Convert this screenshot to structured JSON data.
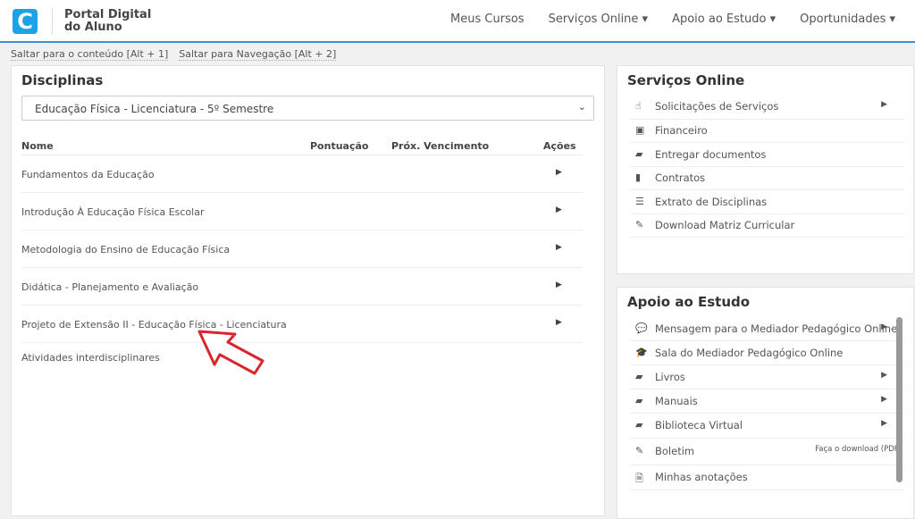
{
  "header": {
    "logo_letter": "C",
    "brand": "Portal Digital do Aluno",
    "nav": [
      "Meus Cursos",
      "Serviços Online ▾",
      "Apoio ao Estudo ▾",
      "Oportunidades ▾"
    ]
  },
  "skip_links": [
    "Saltar para o conteúdo [Alt + 1]",
    "Saltar para Navegação [Alt + 2]"
  ],
  "disciplinas": {
    "title": "Disciplinas",
    "selected_course": "Educação Física - Licenciatura - 5º Semestre",
    "columns": [
      "Nome",
      "Pontuação",
      "Próx. Vencimento",
      "Ações"
    ],
    "rows": [
      {
        "name": "Fundamentos da Educação",
        "action": true
      },
      {
        "name": "Introdução À Educação Física Escolar",
        "action": true
      },
      {
        "name": "Metodologia do Ensino de Educação Física",
        "action": true
      },
      {
        "name": "Didática - Planejamento e Avaliação",
        "action": true
      },
      {
        "name": "Projeto de Extensão II - Educação Física - Licenciatura",
        "action": true
      },
      {
        "name": "Atividades interdisciplinares",
        "action": false
      }
    ]
  },
  "servicos": {
    "title": "Serviços Online",
    "items": [
      {
        "icon": "hand-pointer-icon",
        "glyph": "☝",
        "label": "Solicitações de Serviços",
        "arrow": true
      },
      {
        "icon": "money-icon",
        "glyph": "▣",
        "label": "Financeiro"
      },
      {
        "icon": "folder-icon",
        "glyph": "▰",
        "label": "Entregar documentos"
      },
      {
        "icon": "file-icon",
        "glyph": "▮",
        "label": "Contratos"
      },
      {
        "icon": "list-icon",
        "glyph": "☰",
        "label": "Extrato de Disciplinas"
      },
      {
        "icon": "edit-icon",
        "glyph": "✎",
        "label": "Download Matriz Curricular"
      }
    ]
  },
  "apoio": {
    "title": "Apoio ao Estudo",
    "items": [
      {
        "icon": "comments-icon",
        "glyph": "💬",
        "label": "Mensagem para o Mediador Pedagógico Online",
        "arrow": true
      },
      {
        "icon": "graduation-cap-icon",
        "glyph": "🎓",
        "label": "Sala do Mediador Pedagógico Online"
      },
      {
        "icon": "book-icon",
        "glyph": "▰",
        "label": "Livros",
        "arrow": true
      },
      {
        "icon": "book-icon",
        "glyph": "▰",
        "label": "Manuais",
        "arrow": true
      },
      {
        "icon": "book-icon",
        "glyph": "▰",
        "label": "Biblioteca Virtual",
        "arrow": true
      },
      {
        "icon": "edit-icon",
        "glyph": "✎",
        "label": "Boletim",
        "note": "Faça o download (PDF)"
      },
      {
        "icon": "file-text-icon",
        "glyph": "🗎",
        "label": "Minhas anotações"
      }
    ]
  },
  "colors": {
    "accent": "#3d8fd6",
    "logo": "#1aa3e8",
    "annotation_arrow": "#d9262c"
  }
}
